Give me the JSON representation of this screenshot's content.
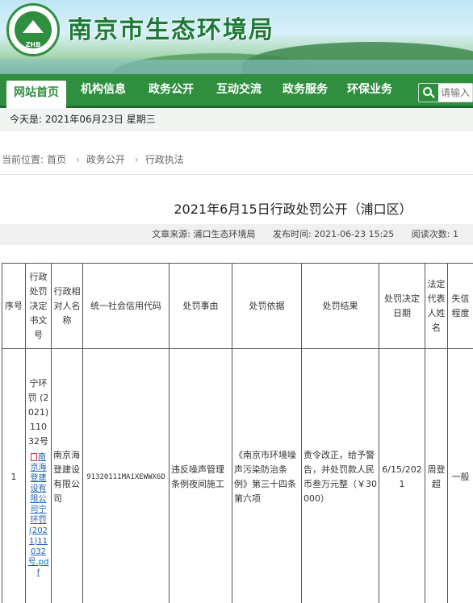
{
  "header": {
    "site_title": "南京市生态环境局",
    "logo_text": "ZHB"
  },
  "nav": {
    "items": [
      {
        "label": "网站首页"
      },
      {
        "label": "机构信息"
      },
      {
        "label": "政务公开"
      },
      {
        "label": "互动交流"
      },
      {
        "label": "政务服务"
      },
      {
        "label": "环保业务"
      }
    ],
    "search_placeholder": "请输入"
  },
  "datebar": {
    "text": "今天是:  2021年06月23日  星期三"
  },
  "breadcrumb": {
    "prefix": "当前位置:",
    "items": [
      "首页",
      "政务公开",
      "行政执法"
    ]
  },
  "article": {
    "title": "2021年6月15日行政处罚公开（浦口区）",
    "source": "文章来源: 浦口生态环境局",
    "publish_time": "发布时间: 2021-06-23 15:25",
    "read_count": "阅读次数: 1"
  },
  "table": {
    "headers": [
      "序号",
      "行政处罚决定书文号",
      "行政相对人名称",
      "统一社会信用代码",
      "处罚事由",
      "处罚依据",
      "处罚结果",
      "处罚决定日期",
      "法定代表人姓名",
      "失信程度"
    ],
    "rows": [
      {
        "index": "1",
        "doc_number": "宁环罚 (2021) 11032号",
        "doc_link": "南京海登建设有限公司宁环罚(2021)11032号.pdf",
        "party": "南京海登建设有限公司",
        "credit_code": "91320111MA1XEWWX6D",
        "reason": "违反噪声管理条例夜间施工",
        "basis": "《南京市环境噪声污染防治条例》第三十四条第六项",
        "result": "责令改正，给予警告，并处罚款人民币叁万元整（￥30000）",
        "date": "6/15/2021",
        "legal_rep": "周登超",
        "credit_level": "一般"
      }
    ]
  }
}
